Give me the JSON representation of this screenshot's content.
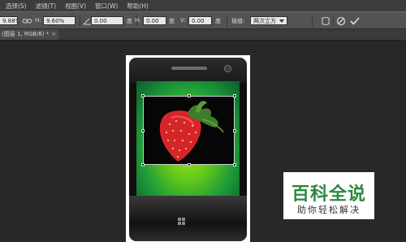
{
  "menu": [
    "选择(S)",
    "滤镜(T)",
    "视图(V)",
    "窗口(W)",
    "帮助(H)"
  ],
  "options": {
    "width_partial": "9.88%",
    "height_label": "H:",
    "height_value": "9.60%",
    "angle_value": "0.00",
    "angle_unit": "度",
    "hskew_label": "H:",
    "hskew_value": "0.00",
    "hskew_unit": "度",
    "vskew_label": "V:",
    "vskew_value": "0.00",
    "vskew_unit": "度",
    "interp_label": "插值:",
    "interp_value": "两次立方"
  },
  "tab": {
    "label": "(图层 1, RGB/8) *",
    "close": "×"
  },
  "watermark": {
    "title": "百科全说",
    "subtitle": "助你轻松解决"
  },
  "colors": {
    "brand_green": "#2b8a3e",
    "screen_green": "#62c81a"
  },
  "icons": [
    "link-icon",
    "angle-icon",
    "warp-toggle-icon",
    "cancel-transform-icon",
    "commit-transform-icon"
  ]
}
